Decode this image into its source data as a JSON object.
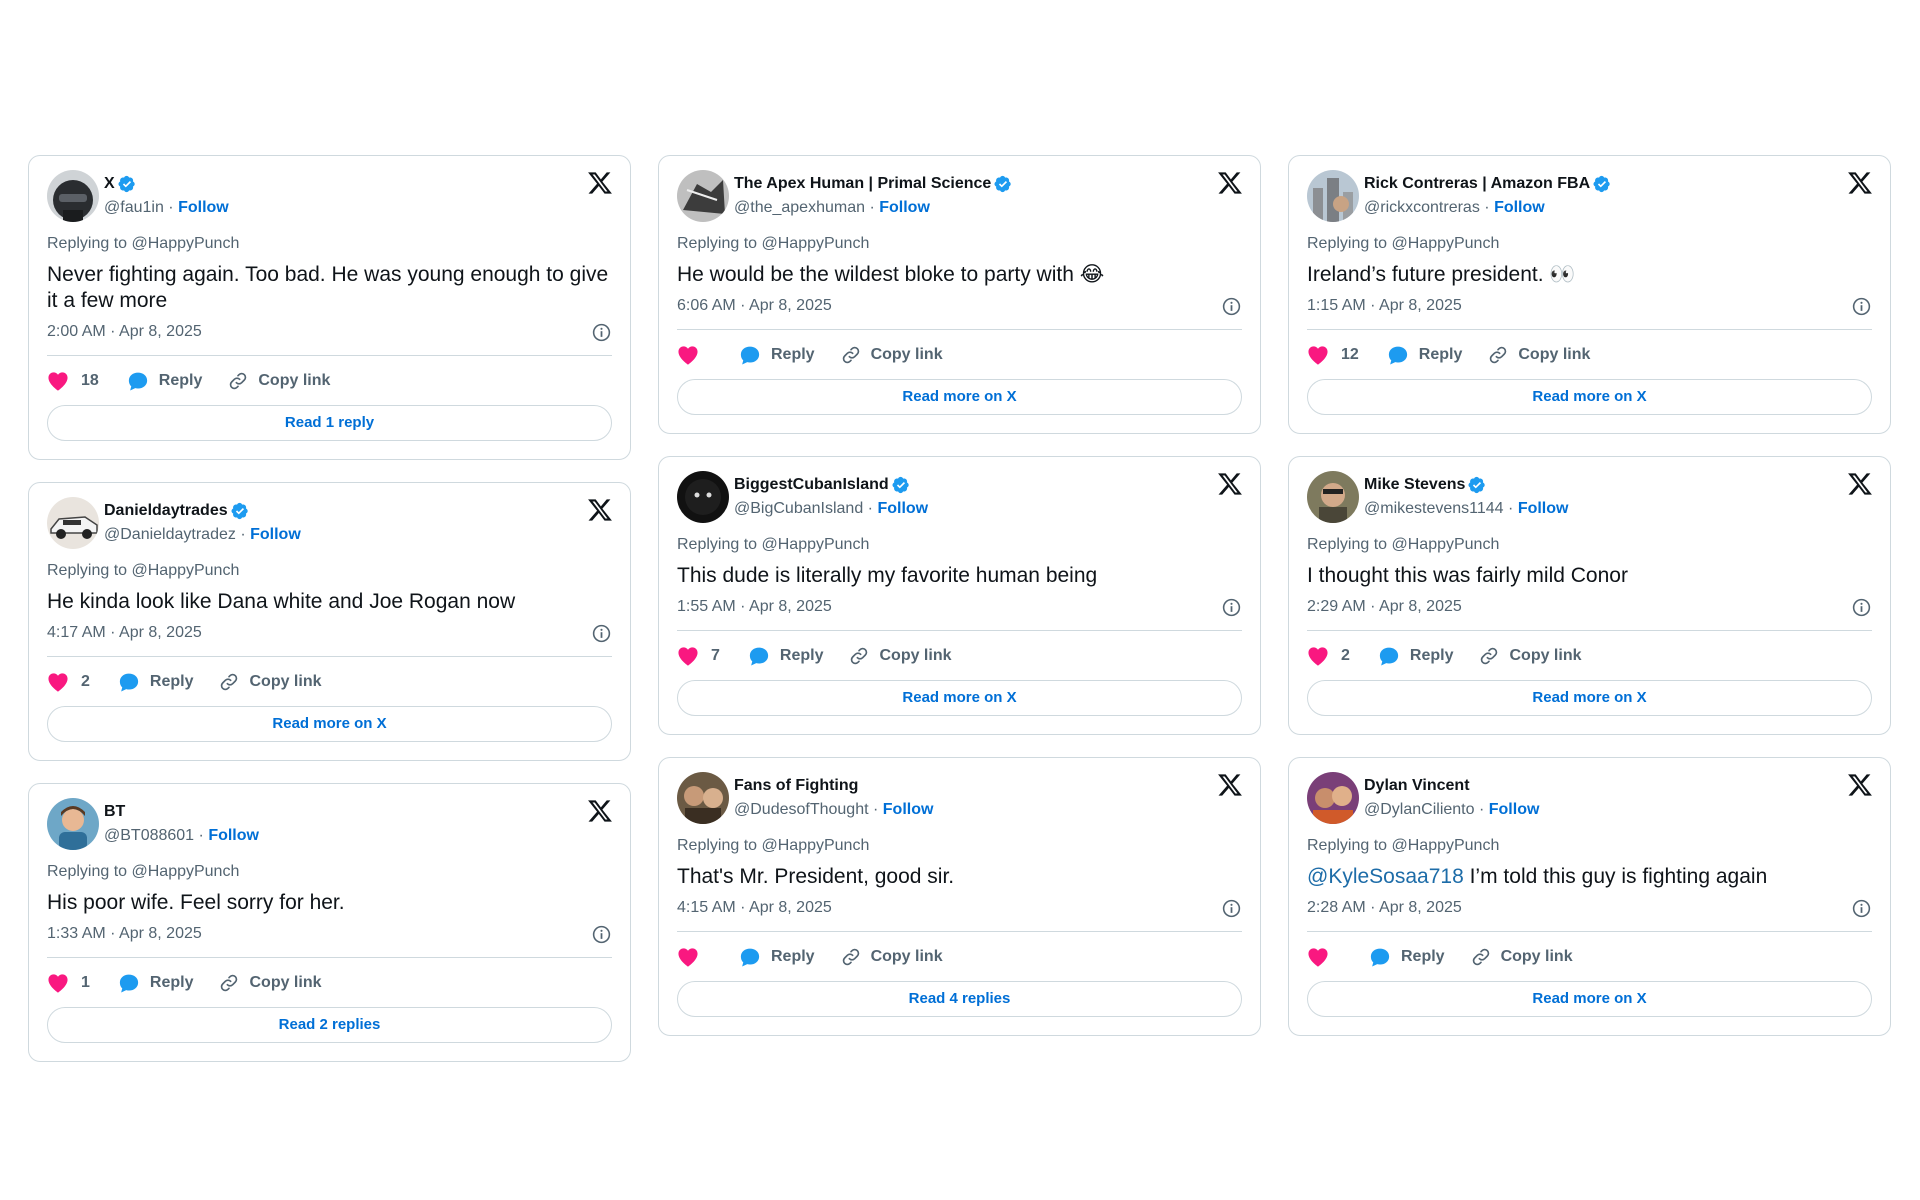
{
  "columns": [
    [
      {
        "name": "X",
        "verified": true,
        "handle": "@fau1in",
        "follow": "Follow",
        "replying": "Replying to @HappyPunch",
        "mention": "",
        "text": "Never fighting again. Too bad. He was young enough to give it a few more",
        "time": "2:00 AM · Apr 8, 2025",
        "likes": "18",
        "reply": "Reply",
        "copy": "Copy link",
        "button": "Read 1 reply",
        "avatar": "helmet"
      },
      {
        "name": "Danieldaytrades",
        "verified": true,
        "handle": "@Danieldaytradez",
        "follow": "Follow",
        "replying": "Replying to @HappyPunch",
        "mention": "",
        "text": "He kinda look like Dana white and Joe Rogan now",
        "time": "4:17 AM · Apr 8, 2025",
        "likes": "2",
        "reply": "Reply",
        "copy": "Copy link",
        "button": "Read more on X",
        "avatar": "car"
      },
      {
        "name": "BT",
        "verified": false,
        "handle": "@BT088601",
        "follow": "Follow",
        "replying": "Replying to @HappyPunch",
        "mention": "",
        "text": "His poor wife. Feel sorry for her.",
        "time": "1:33 AM · Apr 8, 2025",
        "likes": "1",
        "reply": "Reply",
        "copy": "Copy link",
        "button": "Read 2 replies",
        "avatar": "cartoon"
      }
    ],
    [
      {
        "name": "The Apex Human | Primal Science",
        "verified": true,
        "handle": "@the_apexhuman",
        "follow": "Follow",
        "replying": "Replying to @HappyPunch",
        "mention": "",
        "text": "He would be the wildest bloke to party with 😂",
        "time": "6:06 AM · Apr 8, 2025",
        "likes": "",
        "reply": "Reply",
        "copy": "Copy link",
        "button": "Read more on X",
        "avatar": "sketch"
      },
      {
        "name": "BiggestCubanIsland",
        "verified": true,
        "handle": "@BigCubanIsland",
        "follow": "Follow",
        "replying": "Replying to @HappyPunch",
        "mention": "",
        "text": "This dude is literally my favorite human being",
        "time": "1:55 AM · Apr 8, 2025",
        "likes": "7",
        "reply": "Reply",
        "copy": "Copy link",
        "button": "Read more on X",
        "avatar": "dark"
      },
      {
        "name": "Fans of Fighting",
        "verified": false,
        "handle": "@DudesofThought",
        "follow": "Follow",
        "replying": "Replying to @HappyPunch",
        "mention": "",
        "text": "That's Mr. President, good sir.",
        "time": "4:15 AM · Apr 8, 2025",
        "likes": "",
        "reply": "Reply",
        "copy": "Copy link",
        "button": "Read 4 replies",
        "avatar": "faces"
      }
    ],
    [
      {
        "name": "Rick Contreras | Amazon FBA",
        "verified": true,
        "handle": "@rickxcontreras",
        "follow": "Follow",
        "replying": "Replying to @HappyPunch",
        "mention": "",
        "text": "Ireland’s future president. 👀",
        "time": "1:15 AM · Apr 8, 2025",
        "likes": "12",
        "reply": "Reply",
        "copy": "Copy link",
        "button": "Read more on X",
        "avatar": "city"
      },
      {
        "name": "Mike Stevens",
        "verified": true,
        "handle": "@mikestevens1144",
        "follow": "Follow",
        "replying": "Replying to @HappyPunch",
        "mention": "",
        "text": "I thought this was fairly mild Conor",
        "time": "2:29 AM · Apr 8, 2025",
        "likes": "2",
        "reply": "Reply",
        "copy": "Copy link",
        "button": "Read more on X",
        "avatar": "man"
      },
      {
        "name": "Dylan Vincent",
        "verified": false,
        "handle": "@DylanCiliento",
        "follow": "Follow",
        "replying": "Replying to @HappyPunch",
        "mention": "@KyleSosaa718",
        "text": " I’m told this guy is fighting again",
        "time": "2:28 AM · Apr 8, 2025",
        "likes": "",
        "reply": "Reply",
        "copy": "Copy link",
        "button": "Read more on X",
        "avatar": "colorful"
      }
    ]
  ],
  "colors": {
    "follow": "#006fd6",
    "heart": "#f91880",
    "bubble": "#1d9bf0",
    "verified": "#1d9bf0"
  }
}
